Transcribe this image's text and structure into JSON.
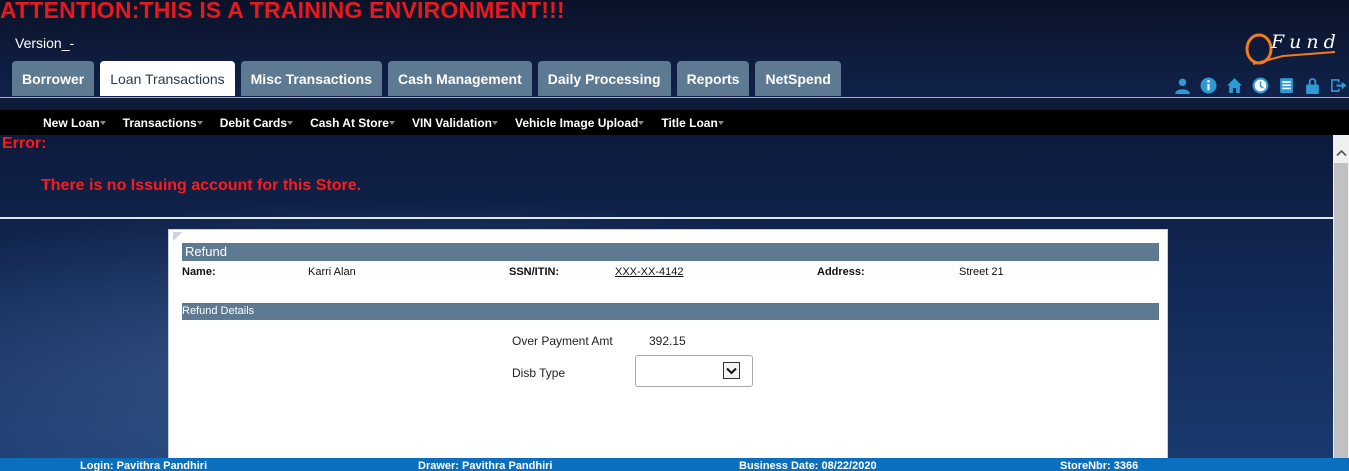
{
  "banner": {
    "attention": "ATTENTION:THIS IS A TRAINING ENVIRONMENT!!!",
    "version": "Version_-"
  },
  "logo": {
    "text": "Fund"
  },
  "tabs": [
    {
      "label": "Borrower",
      "active": false
    },
    {
      "label": "Loan Transactions",
      "active": true
    },
    {
      "label": "Misc Transactions",
      "active": false
    },
    {
      "label": "Cash Management",
      "active": false
    },
    {
      "label": "Daily Processing",
      "active": false
    },
    {
      "label": "Reports",
      "active": false
    },
    {
      "label": "NetSpend",
      "active": false
    }
  ],
  "header_icons": [
    "user-icon",
    "info-icon",
    "home-icon",
    "clock-icon",
    "list-icon",
    "lock-icon",
    "logout-icon"
  ],
  "subnav": [
    {
      "label": "New Loan"
    },
    {
      "label": "Transactions"
    },
    {
      "label": "Debit Cards"
    },
    {
      "label": "Cash At Store"
    },
    {
      "label": "VIN Validation"
    },
    {
      "label": "Vehicle Image Upload"
    },
    {
      "label": "Title Loan"
    }
  ],
  "error": {
    "label": "Error:",
    "message": "There is no Issuing account for this Store."
  },
  "refund": {
    "title": "Refund",
    "name_label": "Name:",
    "name_value": "Karri Alan",
    "ssn_label": "SSN/ITIN:",
    "ssn_value": "XXX-XX-4142",
    "address_label": "Address:",
    "address_value": "Street 21",
    "details_title": "Refund Details",
    "overpayment_label": "Over Payment Amt",
    "overpayment_value": "392.15",
    "disb_type_label": "Disb Type",
    "disb_type_value": ""
  },
  "footer": {
    "login": "Login: Pavithra Pandhiri",
    "drawer": "Drawer: Pavithra Pandhiri",
    "business_date": "Business Date: 08/22/2020",
    "store": "StoreNbr: 3366"
  },
  "colors": {
    "tab_bg": "#5e7a92",
    "error": "#ff1a1a",
    "footer": "#0a6fbf",
    "icon": "#2d9ad6"
  }
}
